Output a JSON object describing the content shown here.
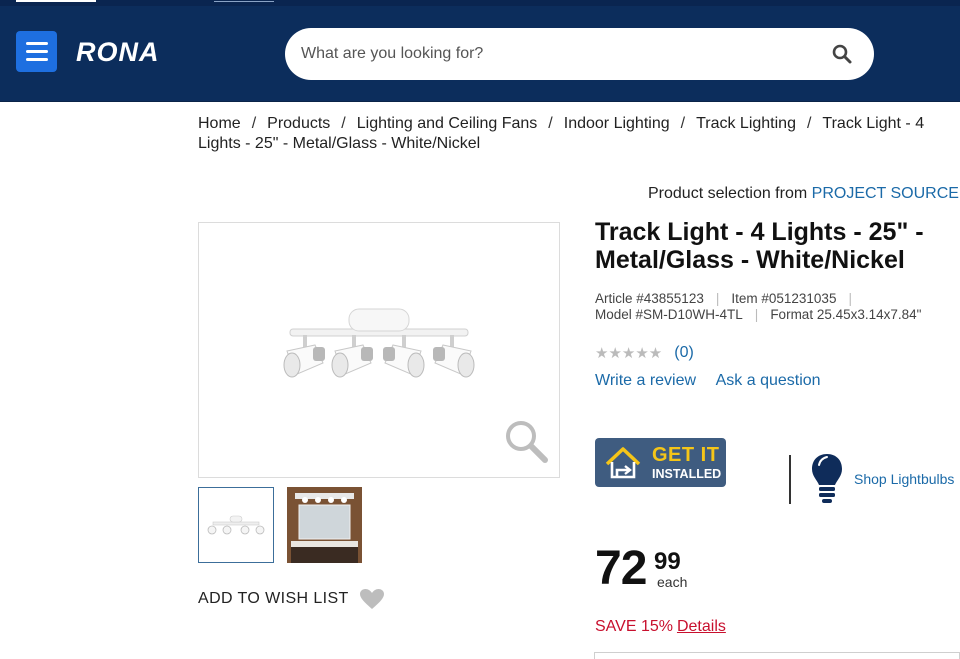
{
  "header": {
    "logo": "RONA",
    "search_placeholder": "What are you looking for?",
    "brand_color": "#0c2d5c",
    "menu_color": "#1e6fe0",
    "icons": [
      "menu-icon",
      "search-icon"
    ]
  },
  "breadcrumb": {
    "items": [
      "Home",
      "Products",
      "Lighting and Ceiling Fans",
      "Indoor Lighting",
      "Track Lighting",
      "Track Light - 4 Lights - 25\" - Metal/Glass - White/Nickel"
    ],
    "separator": "/"
  },
  "vendor": {
    "label": "Product selection from",
    "brand": "PROJECT SOURCE"
  },
  "gallery": {
    "icons": [
      "zoom-icon"
    ]
  },
  "wishlist": {
    "label": "ADD TO WISH LIST"
  },
  "product": {
    "title": "Track Light - 4 Lights - 25\" - Metal/Glass - White/Nickel",
    "article": "Article #43855123",
    "item": "Item #051231035",
    "model": "Model #SM-D10WH-4TL",
    "format": "Format 25.45x3.14x7.84\"",
    "stars": "★★★★★",
    "review_count": "(0)",
    "write_review": "Write a review",
    "ask_question": "Ask a question"
  },
  "install": {
    "line1": "GET IT",
    "line2": "INSTALLED"
  },
  "shop": {
    "label": "Shop Lightbulbs"
  },
  "price": {
    "dollars": "72",
    "cents": "99",
    "unit": "each"
  },
  "save": {
    "text": "SAVE 15%",
    "details": "Details",
    "color": "#c8102e"
  }
}
